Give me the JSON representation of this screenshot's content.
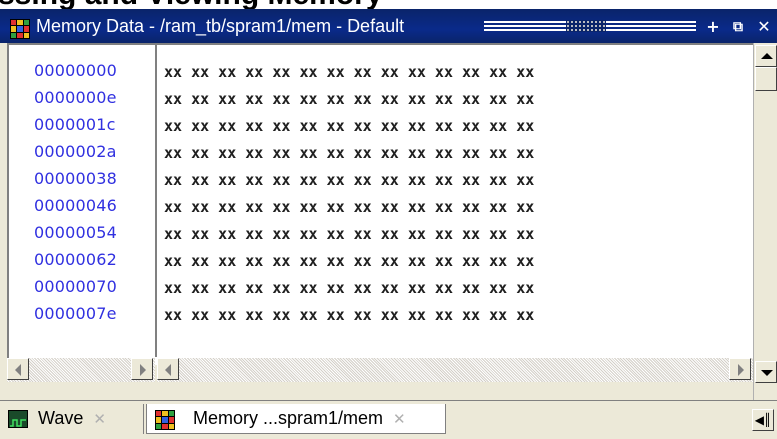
{
  "window": {
    "title": "Memory Data - /ram_tb/spram1/mem - Default",
    "buttons": {
      "dock": "+",
      "undock": "⧉",
      "close": "✕"
    }
  },
  "background_text": "ssing and Viewing Memory",
  "memory": {
    "rows": [
      {
        "address": "00000000",
        "data": "xx xx xx xx xx xx xx xx xx xx xx xx xx xx"
      },
      {
        "address": "0000000e",
        "data": "xx xx xx xx xx xx xx xx xx xx xx xx xx xx"
      },
      {
        "address": "0000001c",
        "data": "xx xx xx xx xx xx xx xx xx xx xx xx xx xx"
      },
      {
        "address": "0000002a",
        "data": "xx xx xx xx xx xx xx xx xx xx xx xx xx xx"
      },
      {
        "address": "00000038",
        "data": "xx xx xx xx xx xx xx xx xx xx xx xx xx xx"
      },
      {
        "address": "00000046",
        "data": "xx xx xx xx xx xx xx xx xx xx xx xx xx xx"
      },
      {
        "address": "00000054",
        "data": "xx xx xx xx xx xx xx xx xx xx xx xx xx xx"
      },
      {
        "address": "00000062",
        "data": "xx xx xx xx xx xx xx xx xx xx xx xx xx xx"
      },
      {
        "address": "00000070",
        "data": "xx xx xx xx xx xx xx xx xx xx xx xx xx xx"
      },
      {
        "address": "0000007e",
        "data": "xx xx xx xx xx xx xx xx xx xx xx xx xx xx"
      }
    ]
  },
  "tabs": [
    {
      "label": "Wave",
      "icon": "wave-icon",
      "close": "✕"
    },
    {
      "label": "Memory ...spram1/mem",
      "icon": "memory-grid-icon",
      "close": "✕"
    }
  ],
  "tab_scroll": "◀║",
  "colors": {
    "title_bg": "#0a246a",
    "address_blue": "#3030e0",
    "chrome": "#ece9d8"
  }
}
